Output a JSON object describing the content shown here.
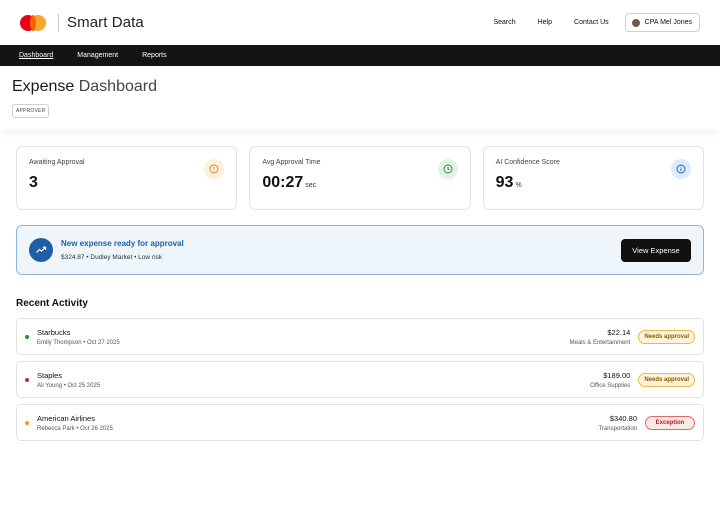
{
  "header": {
    "brand": "Smart Data",
    "links": [
      "Search",
      "Help",
      "Contact Us"
    ],
    "user": "CPA Mel Jones"
  },
  "nav": {
    "items": [
      {
        "label": "Dashboard",
        "active": true
      },
      {
        "label": "Management",
        "active": false
      },
      {
        "label": "Reports",
        "active": false
      }
    ]
  },
  "page": {
    "title_part1": "Expense",
    "title_part2": "Dashboard",
    "role": "APPROVER"
  },
  "stats": [
    {
      "label": "Awaiting Approval",
      "value": "3",
      "unit": "",
      "icon": "alert-circle-icon",
      "icon_bg": "#fdf0dc",
      "icon_color": "#c9871c"
    },
    {
      "label": "Avg Approval Time",
      "value": "00:27",
      "unit": "sec",
      "icon": "clock-icon",
      "icon_bg": "#e2f3e4",
      "icon_color": "#2e8b3e"
    },
    {
      "label": "AI Confidence Score",
      "value": "93",
      "unit": "%",
      "icon": "info-icon",
      "icon_bg": "#dcebfa",
      "icon_color": "#1f5fa8"
    }
  ],
  "banner": {
    "title": "New expense ready for approval",
    "subtitle": "$324.87 • Dudley Market • Low risk",
    "button": "View Expense",
    "icon": "trending-up-icon"
  },
  "recent": {
    "title": "Recent Activity",
    "items": [
      {
        "merchant": "Starbucks",
        "meta": "Emily Thompson • Oct 27 2025",
        "amount": "$22.14",
        "category": "Meals & Entertainment",
        "status": "Needs approval",
        "status_type": "pending",
        "dot": "#2e8b3e"
      },
      {
        "merchant": "Staples",
        "meta": "Ali Young • Oct 25 2025",
        "amount": "$189.00",
        "category": "Office Supplies",
        "status": "Needs approval",
        "status_type": "pending",
        "dot": "#c62828"
      },
      {
        "merchant": "American Airlines",
        "meta": "Rebecca Park • Oct 26 2025",
        "amount": "$340.80",
        "category": "Transportation",
        "status": "Exception",
        "status_type": "exception",
        "dot": "#f59e0b"
      }
    ]
  }
}
